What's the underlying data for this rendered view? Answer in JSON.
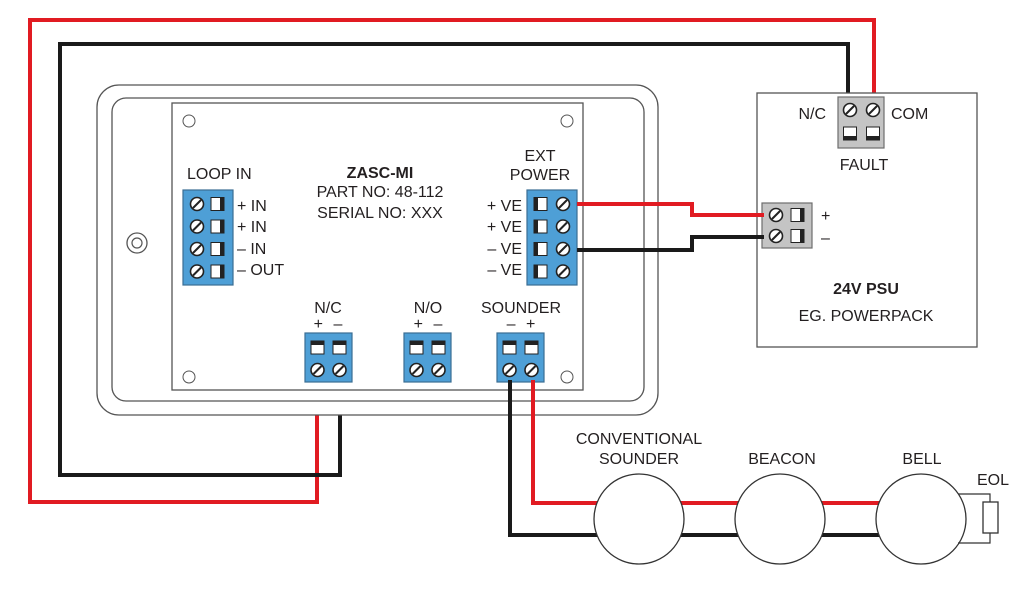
{
  "colors": {
    "wire_positive": "#e11b22",
    "wire_negative": "#1a1a1a",
    "terminal_block": "#4e9fd6",
    "psu_terminal_block": "#c4c4c4"
  },
  "module": {
    "name": "ZASC-MI",
    "part_no": "PART NO: 48-112",
    "serial_no": "SERIAL NO: XXX",
    "loop_in": {
      "title": "LOOP IN",
      "terminals": [
        "+ IN",
        "+ IN",
        "– IN",
        "– OUT"
      ]
    },
    "ext_power": {
      "title_1": "EXT",
      "title_2": "POWER",
      "terminals": [
        "+ VE",
        "+ VE",
        "– VE",
        "– VE"
      ]
    },
    "nc": {
      "title": "N/C",
      "polarity": "+ –"
    },
    "no": {
      "title": "N/O",
      "polarity": "+ –"
    },
    "sounder": {
      "title": "SOUNDER",
      "polarity": "– +"
    }
  },
  "psu": {
    "title": "24V PSU",
    "subtitle": "EG. POWERPACK",
    "fault_label": "FAULT",
    "nc_label": "N/C",
    "com_label": "COM",
    "plus_label": "+",
    "minus_label": "–"
  },
  "devices": [
    {
      "label_1": "CONVENTIONAL",
      "label_2": "SOUNDER"
    },
    {
      "label_1": "BEACON"
    },
    {
      "label_1": "BELL"
    }
  ],
  "eol_label": "EOL"
}
